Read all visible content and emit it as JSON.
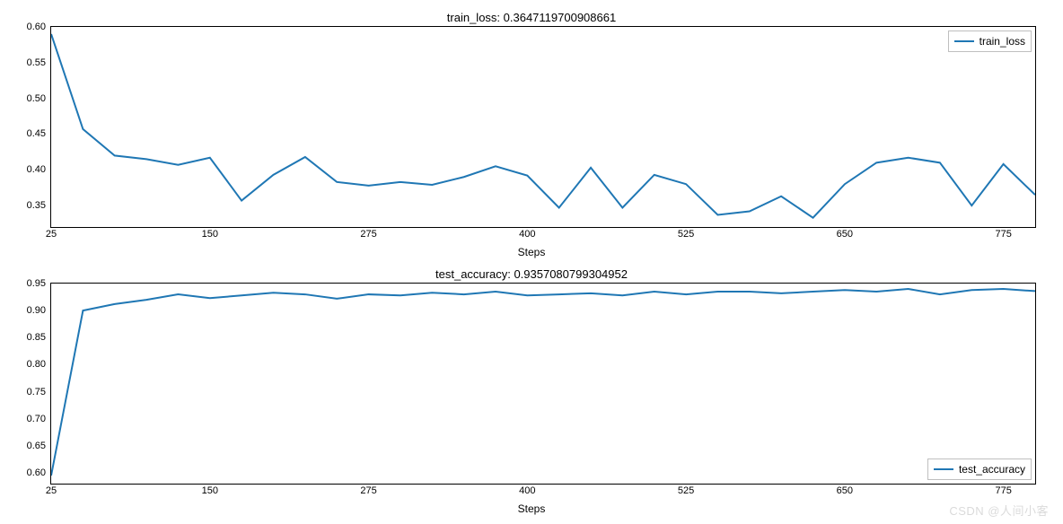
{
  "chart_data": [
    {
      "type": "line",
      "title": "train_loss: 0.3647119700908661",
      "xlabel": "Steps",
      "ylabel": "",
      "xlim": [
        25,
        800
      ],
      "ylim": [
        0.32,
        0.6
      ],
      "x_ticks": [
        25,
        150,
        275,
        400,
        525,
        650,
        775
      ],
      "y_ticks": [
        0.35,
        0.4,
        0.45,
        0.5,
        0.55,
        0.6
      ],
      "legend_position": "top-right",
      "series": [
        {
          "name": "train_loss",
          "x": [
            25,
            50,
            75,
            100,
            125,
            150,
            175,
            200,
            225,
            250,
            275,
            300,
            325,
            350,
            375,
            400,
            425,
            450,
            475,
            500,
            525,
            550,
            575,
            600,
            625,
            650,
            675,
            700,
            725,
            750,
            775,
            800
          ],
          "values": [
            0.59,
            0.457,
            0.42,
            0.415,
            0.407,
            0.417,
            0.357,
            0.393,
            0.418,
            0.383,
            0.378,
            0.383,
            0.379,
            0.39,
            0.405,
            0.392,
            0.347,
            0.403,
            0.347,
            0.393,
            0.38,
            0.337,
            0.342,
            0.363,
            0.333,
            0.38,
            0.41,
            0.417,
            0.41,
            0.35,
            0.408,
            0.365
          ]
        }
      ]
    },
    {
      "type": "line",
      "title": "test_accuracy: 0.9357080799304952",
      "xlabel": "Steps",
      "ylabel": "",
      "xlim": [
        25,
        800
      ],
      "ylim": [
        0.58,
        0.95
      ],
      "x_ticks": [
        25,
        150,
        275,
        400,
        525,
        650,
        775
      ],
      "y_ticks": [
        0.6,
        0.65,
        0.7,
        0.75,
        0.8,
        0.85,
        0.9,
        0.95
      ],
      "legend_position": "bottom-right",
      "series": [
        {
          "name": "test_accuracy",
          "x": [
            25,
            50,
            75,
            100,
            125,
            150,
            175,
            200,
            225,
            250,
            275,
            300,
            325,
            350,
            375,
            400,
            425,
            450,
            475,
            500,
            525,
            550,
            575,
            600,
            625,
            650,
            675,
            700,
            725,
            750,
            775,
            800
          ],
          "values": [
            0.595,
            0.9,
            0.912,
            0.92,
            0.93,
            0.923,
            0.928,
            0.933,
            0.93,
            0.922,
            0.93,
            0.928,
            0.933,
            0.93,
            0.935,
            0.928,
            0.93,
            0.932,
            0.928,
            0.935,
            0.93,
            0.935,
            0.935,
            0.932,
            0.935,
            0.938,
            0.935,
            0.94,
            0.93,
            0.938,
            0.94,
            0.936
          ]
        }
      ]
    }
  ],
  "line_color": "#1f77b4",
  "watermark": "CSDN @人间小客"
}
